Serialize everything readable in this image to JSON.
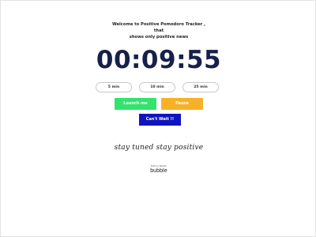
{
  "header": {
    "welcome_line1": "Welcome to Positive Pomodoro Tracker , that",
    "welcome_line2": "shows only positive news"
  },
  "timer": {
    "display": "00:09:55"
  },
  "durations": {
    "five": "5 min",
    "ten": "10 min",
    "twentyfive": "25 min"
  },
  "actions": {
    "launch": "Launch me",
    "pause": "Pause",
    "cant_wait": "Can't Wait !!"
  },
  "tagline": {
    "text": "stay tuned stay positive"
  },
  "badge": {
    "small": "Built on Bubble",
    "big": "bubble"
  },
  "colors": {
    "launch": "#32e36c",
    "pause": "#f7b128",
    "cant_wait": "#0f14bd",
    "timer": "#17204a"
  }
}
